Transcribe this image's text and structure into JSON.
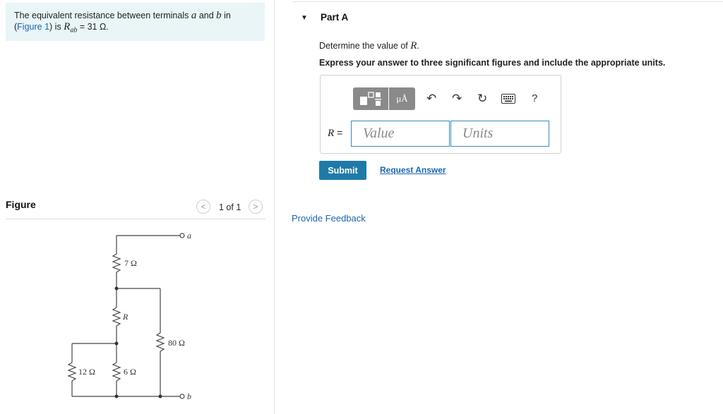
{
  "problem": {
    "text_before": "The equivalent resistance between terminals ",
    "var_a": "a",
    "text_and": " and ",
    "var_b": "b",
    "text_in": " in",
    "paren_open": "(",
    "figure_link": "Figure 1",
    "text_is": ") is ",
    "r_ab_symbol": "R",
    "r_ab_sub": "ab",
    "r_ab_value": " = 31 Ω."
  },
  "figure": {
    "title": "Figure",
    "pager": "1 of 1",
    "prev_icon": "chevron-left-icon",
    "next_icon": "chevron-right-icon",
    "labels": {
      "terminal_a": "a",
      "terminal_b": "b",
      "r7": "7 Ω",
      "r_unknown": "R",
      "r80": "80 Ω",
      "r12": "12 Ω",
      "r6": "6 Ω"
    }
  },
  "partA": {
    "title": "Part A",
    "question_prefix": "Determine the value of ",
    "question_var": "R",
    "question_suffix": ".",
    "instructions": "Express your answer to three significant figures and include the appropriate units."
  },
  "answer": {
    "label_var": "R",
    "label_eq": " =",
    "value_placeholder": "Value",
    "units_placeholder": "Units",
    "toolbar": {
      "units_label": "μÅ",
      "help_label": "?"
    }
  },
  "actions": {
    "submit": "Submit",
    "request_answer": "Request Answer",
    "provide_feedback": "Provide Feedback"
  },
  "colors": {
    "problem_bg": "#e9f5f7",
    "link": "#1a66b0",
    "submit_bg": "#1f7aa8",
    "field_border": "#3a8ac0"
  }
}
